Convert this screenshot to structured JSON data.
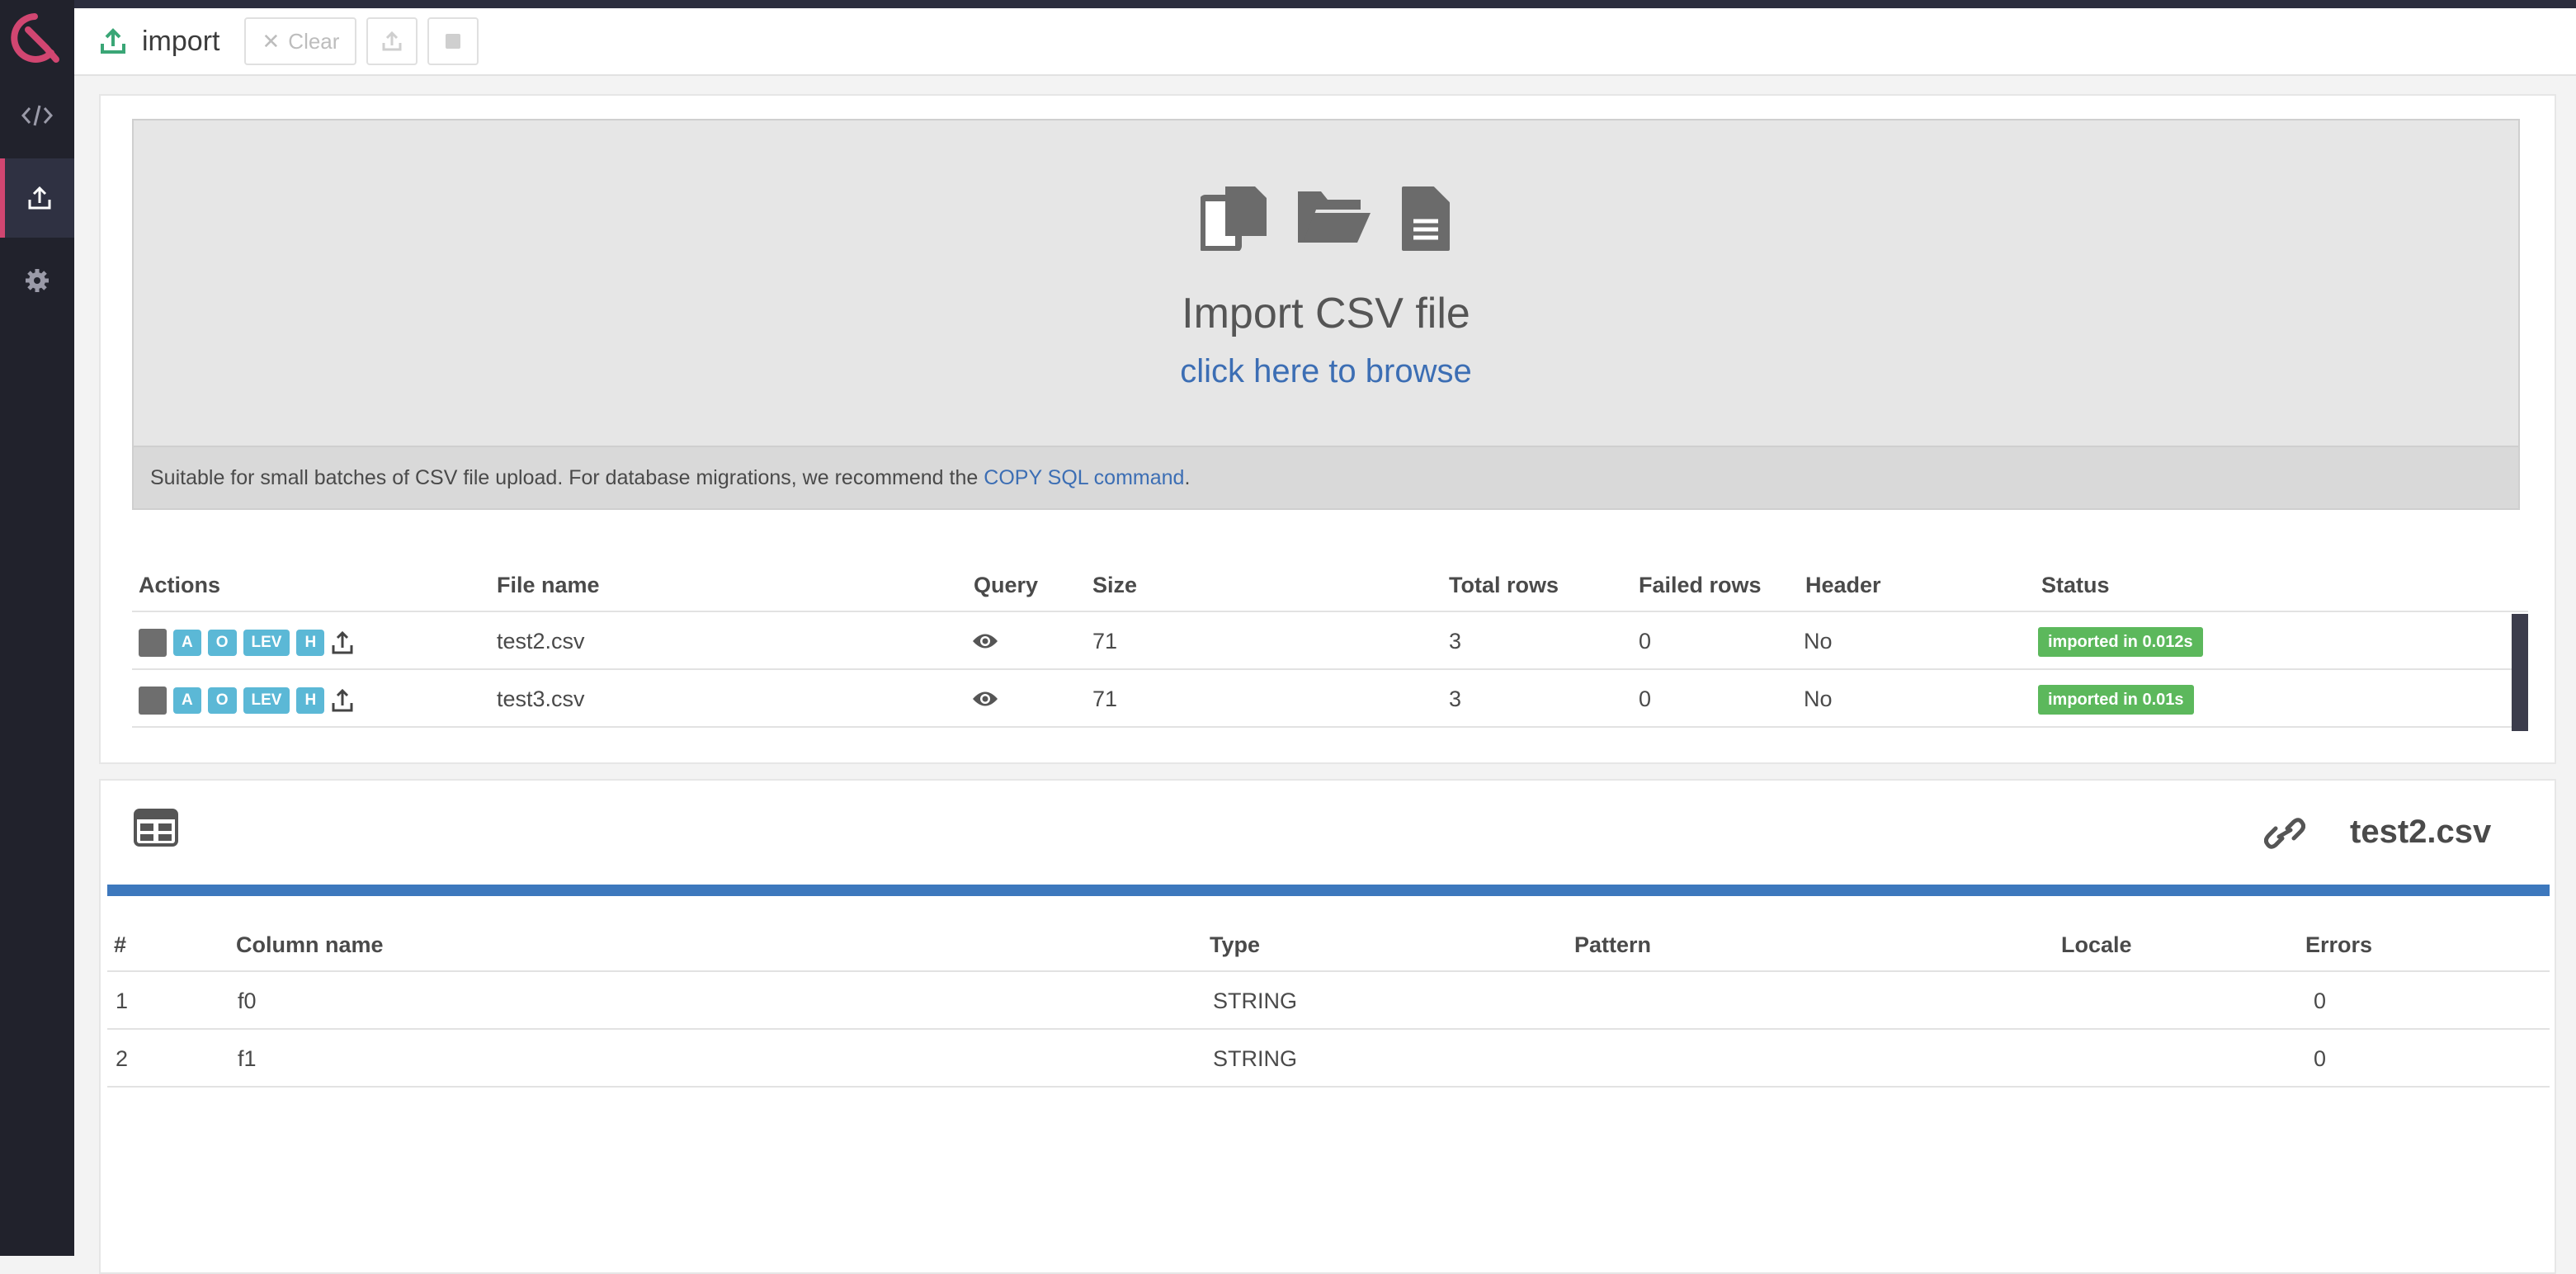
{
  "app": {
    "accent_color": "#d14671",
    "sidebar_color": "#21222c"
  },
  "sidebar": {
    "items": [
      {
        "name": "code-icon",
        "active": false
      },
      {
        "name": "import-icon",
        "active": true
      },
      {
        "name": "gear-icon",
        "active": false
      }
    ]
  },
  "header": {
    "title": "import",
    "clear_label": "Clear"
  },
  "dropzone": {
    "title": "Import CSV file",
    "browse": "click here to browse",
    "note_text": "Suitable for small batches of CSV file upload. For database migrations, we recommend the",
    "note_link": "COPY SQL command",
    "note_end": "."
  },
  "files_table": {
    "columns": [
      "Actions",
      "File name",
      "Query",
      "Size",
      "Total rows",
      "Failed rows",
      "Header",
      "Status"
    ],
    "action_pills": [
      "A",
      "O",
      "LEV",
      "H"
    ],
    "rows": [
      {
        "file": "test2.csv",
        "size": "71",
        "total": "3",
        "failed": "0",
        "header": "No",
        "status": "imported in 0.012s",
        "status_color": "#5cb85c"
      },
      {
        "file": "test3.csv",
        "size": "71",
        "total": "3",
        "failed": "0",
        "header": "No",
        "status": "imported in 0.01s",
        "status_color": "#5cb85c"
      }
    ]
  },
  "schema": {
    "file": "test2.csv",
    "bar_color": "#3d78bd",
    "columns": [
      "#",
      "Column name",
      "Type",
      "Pattern",
      "Locale",
      "Errors"
    ],
    "rows": [
      {
        "idx": "1",
        "name": "f0",
        "type": "STRING",
        "pattern": "",
        "locale": "",
        "errors": "0"
      },
      {
        "idx": "2",
        "name": "f1",
        "type": "STRING",
        "pattern": "",
        "locale": "",
        "errors": "0"
      }
    ]
  }
}
